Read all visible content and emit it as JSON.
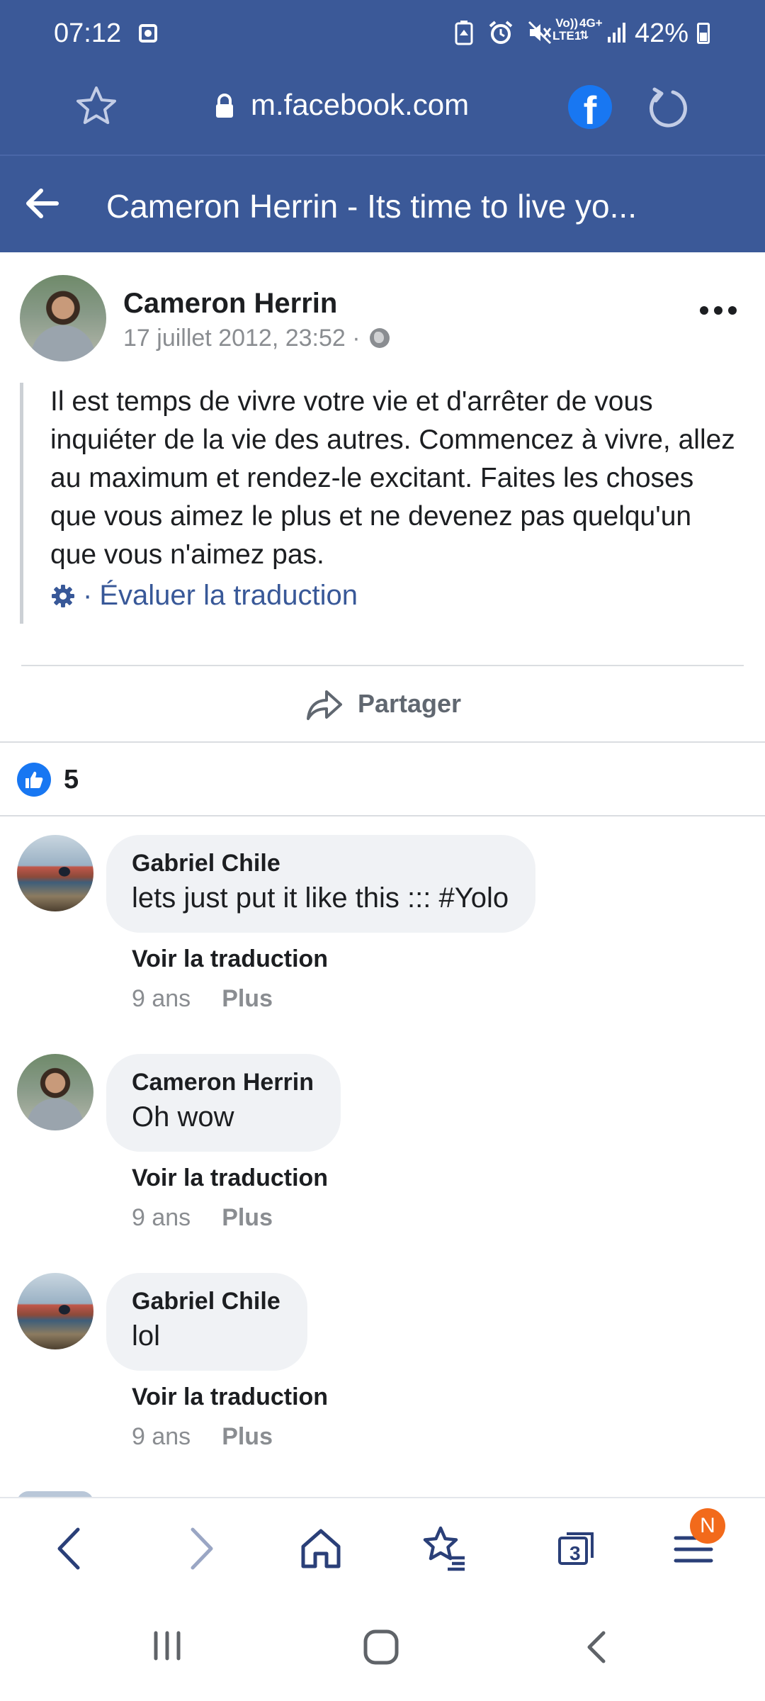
{
  "status_bar": {
    "time": "07:12",
    "net_top": "Vo))",
    "net_bottom": "LTE1",
    "net_type": "4G+",
    "battery": "42%"
  },
  "browser": {
    "url": "m.facebook.com",
    "fb_letter": "f",
    "tab_count": "3",
    "menu_badge": "N"
  },
  "header": {
    "title": "Cameron Herrin - Its time to live yo..."
  },
  "post": {
    "author": "Cameron Herrin",
    "meta": "17 juillet 2012, 23:52 ·",
    "text": "Il est temps de vivre votre vie et d'arrêter de vous inquiéter de la vie des autres. Commencez à vivre, allez au maximum et rendez-le excitant. Faites les choses que vous aimez le plus et ne devenez pas quelqu'un que vous n'aimez pas.",
    "translate_dot": "·",
    "translate_label": "Évaluer la traduction",
    "share_label": "Partager",
    "like_count": "5"
  },
  "comments": [
    {
      "author": "Gabriel Chile",
      "text": "lets just put it like this ::: #Yolo",
      "see_translation": "Voir la traduction",
      "age": "9 ans",
      "more": "Plus"
    },
    {
      "author": "Cameron Herrin",
      "text": "Oh wow",
      "see_translation": "Voir la traduction",
      "age": "9 ans",
      "more": "Plus"
    },
    {
      "author": "Gabriel Chile",
      "text": "lol",
      "see_translation": "Voir la traduction",
      "age": "9 ans",
      "more": "Plus"
    }
  ],
  "colors": {
    "facebook_blue": "#3b5998",
    "link_blue": "#385898",
    "badge_orange": "#f26a1b"
  }
}
